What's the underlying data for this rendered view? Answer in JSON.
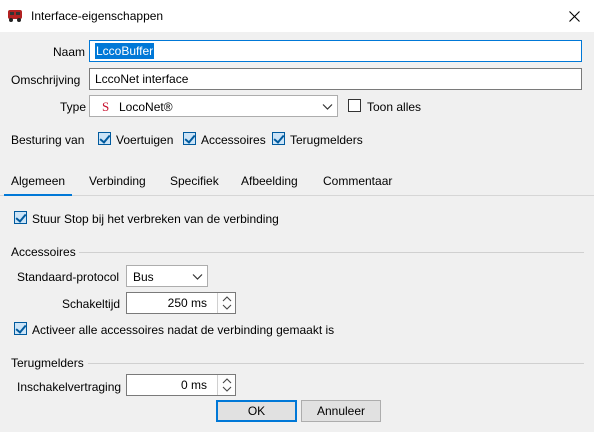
{
  "window": {
    "title": "Interface-eigenschappen"
  },
  "form": {
    "name_label": "Naam",
    "name_value": "LccoBuffer",
    "description_label": "Omschrijving",
    "description_value": "LccoNet interface",
    "type_label": "Type",
    "type_icon_letter": "S",
    "type_value": "LocoNet®",
    "show_all_label": "Toon alles",
    "show_all_checked": false,
    "control_label": "Besturing van",
    "control_options": [
      {
        "label": "Voertuigen",
        "checked": true
      },
      {
        "label": "Accessoires",
        "checked": true
      },
      {
        "label": "Terugmelders",
        "checked": true
      }
    ]
  },
  "tabs": [
    {
      "label": "Algemeen",
      "active": true
    },
    {
      "label": "Verbinding",
      "active": false
    },
    {
      "label": "Specifiek",
      "active": false
    },
    {
      "label": "Afbeelding",
      "active": false
    },
    {
      "label": "Commentaar",
      "active": false
    }
  ],
  "general": {
    "stop_on_disconnect_label": "Stuur Stop bij het verbreken van de verbinding",
    "stop_on_disconnect_checked": true,
    "accessories_section": "Accessoires",
    "default_protocol_label": "Standaard-protocol",
    "default_protocol_value": "Bus",
    "switch_time_label": "Schakeltijd",
    "switch_time_value": "250 ms",
    "activate_all_label": "Activeer alle accessoires nadat de verbinding gemaakt is",
    "activate_all_checked": true,
    "feedback_section": "Terugmelders",
    "switch_on_delay_label": "Inschakelvertraging",
    "switch_on_delay_value": "0 ms"
  },
  "buttons": {
    "ok": "OK",
    "cancel": "Annuleer"
  },
  "colors": {
    "accent": "#0078d7",
    "type_icon": "#c8102e"
  }
}
